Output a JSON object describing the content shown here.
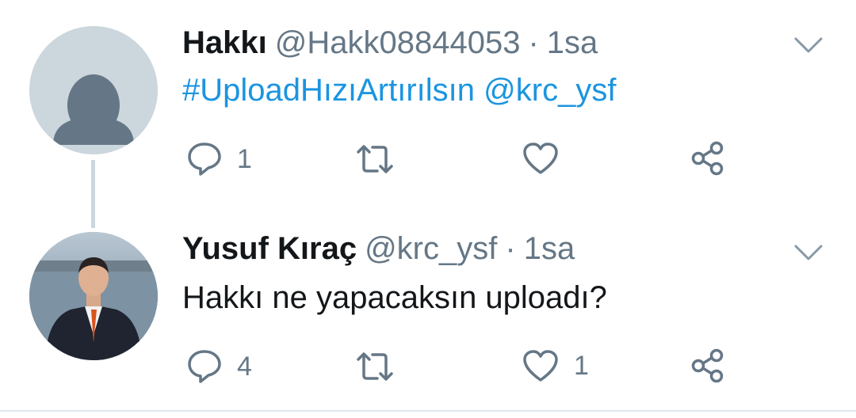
{
  "tweets": [
    {
      "name": "Hakkı",
      "handle": "@Hakk08844053",
      "separator": "·",
      "time": "1sa",
      "text": {
        "hashtag": "#UploadHızıArtırılsın",
        "mention": "@krc_ysf"
      },
      "actions": {
        "reply_count": "1",
        "retweet_count": "",
        "like_count": ""
      },
      "avatar": "default-avatar"
    },
    {
      "name": "Yusuf Kıraç",
      "handle": "@krc_ysf",
      "separator": "·",
      "time": "1sa",
      "text": {
        "body": "Hakkı ne yapacaksın uploadı?"
      },
      "actions": {
        "reply_count": "4",
        "retweet_count": "",
        "like_count": "1"
      },
      "avatar": "profile-photo"
    }
  ],
  "icons": [
    "reply-icon",
    "retweet-icon",
    "like-icon",
    "share-icon",
    "chevron-down-icon"
  ],
  "colors": {
    "link": "#1b95e0",
    "text": "#14171a",
    "secondary": "#657786",
    "thread_line": "#ccd6dd"
  }
}
